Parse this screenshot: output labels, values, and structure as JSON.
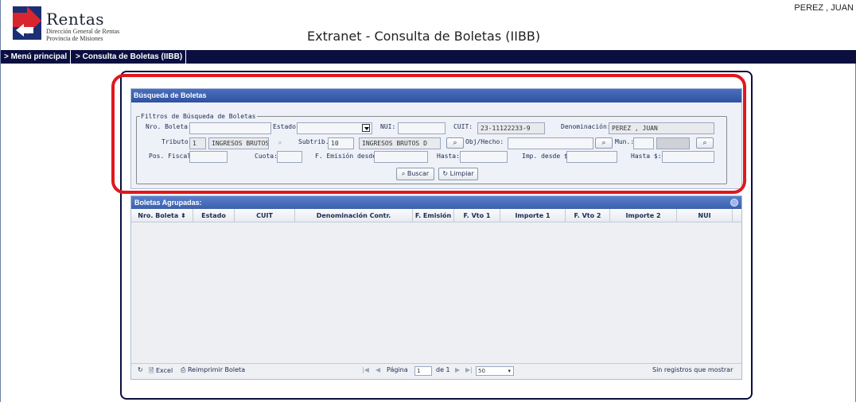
{
  "header": {
    "logo_title": "Rentas",
    "logo_sub1": "Dirección General de Rentas",
    "logo_sub2": "Provincia de Misiones",
    "app_title": "Extranet - Consulta de Boletas (IIBB)",
    "user_name": "PEREZ , JUAN"
  },
  "nav": {
    "items": [
      {
        "label": "> Menú principal"
      },
      {
        "label": "> Consulta de Boletas (IIBB)"
      }
    ]
  },
  "search_panel": {
    "title": "Búsqueda de Boletas",
    "legend": "Filtros de Búsqueda de Boletas",
    "fields": {
      "nro_boleta": {
        "label": "Nro. Boleta:",
        "value": ""
      },
      "estado": {
        "label": "Estado:",
        "value": ""
      },
      "nui": {
        "label": "NUI:",
        "value": ""
      },
      "cuit": {
        "label": "CUIT:",
        "value": "23-11122233-9"
      },
      "denominacion": {
        "label": "Denominación:",
        "value": "PEREZ , JUAN"
      },
      "tributo": {
        "label": "Tributo:",
        "code": "1",
        "desc": "INGRESOS BRUTOS"
      },
      "subtrib": {
        "label": "Subtrib.:",
        "code": "10",
        "desc": "INGRESOS BRUTOS D"
      },
      "obj_hecho": {
        "label": "Obj/Hecho:",
        "value": ""
      },
      "mun": {
        "label": "Mun.:",
        "value": ""
      },
      "pos_fiscal": {
        "label": "Pos. Fiscal:",
        "value": ""
      },
      "cuota": {
        "label": "Cuota:",
        "value": ""
      },
      "f_emision_desde": {
        "label": "F. Emisión desde:",
        "value": ""
      },
      "hasta": {
        "label": "Hasta:",
        "value": ""
      },
      "imp_desde": {
        "label": "Imp. desde $:",
        "value": ""
      },
      "hasta_imp": {
        "label": "Hasta $:",
        "value": ""
      }
    },
    "buscar_label": "Buscar",
    "limpiar_label": "Limpiar"
  },
  "grid": {
    "title": "Boletas Agrupadas:",
    "columns": [
      "Nro. Boleta",
      "Estado",
      "CUIT",
      "Denominación Contr.",
      "F. Emisión",
      "F. Vto 1",
      "Importe 1",
      "F. Vto 2",
      "Importe 2",
      "NUI"
    ],
    "rows": [],
    "footer": {
      "excel_label": "Excel",
      "reprint_label": "Reimprimir Boleta",
      "page_label": "Página",
      "page_value": "1",
      "of_label": "de 1",
      "page_size": "50",
      "empty_message": "Sin registros que mostrar"
    }
  },
  "colors": {
    "nav_bg": "#0a0f3f",
    "panel_header": "#2f52a1",
    "highlight": "#e0181e"
  }
}
